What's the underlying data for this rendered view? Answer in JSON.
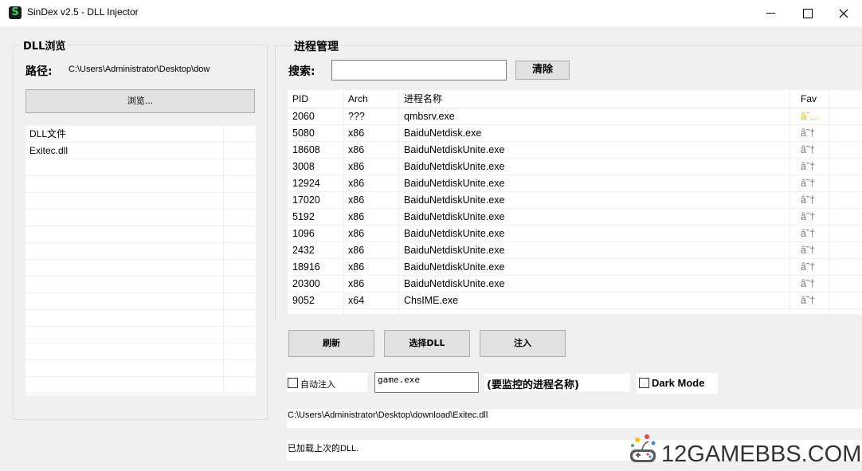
{
  "window": {
    "title": "SinDex v2.5 - DLL Injector",
    "icon_letter": "S"
  },
  "dll_panel": {
    "group_title": "DLL浏览",
    "path_label": "路径:",
    "path_value": "C:\\Users\\Administrator\\Desktop\\dow",
    "browse_button": "浏览...",
    "list_header": "DLL文件",
    "files": [
      "Exitec.dll"
    ]
  },
  "process_panel": {
    "group_title": "进程管理",
    "search_label": "搜索:",
    "search_value": "",
    "clear_button": "清除",
    "columns": {
      "pid": "PID",
      "arch": "Arch",
      "name": "进程名称",
      "fav": "Fav"
    },
    "rows": [
      {
        "pid": "2060",
        "arch": "???",
        "name": "qmbsrv.exe",
        "fav": "â˜…"
      },
      {
        "pid": "5080",
        "arch": "x86",
        "name": "BaiduNetdisk.exe",
        "fav": "â˜†"
      },
      {
        "pid": "18608",
        "arch": "x86",
        "name": "BaiduNetdiskUnite.exe",
        "fav": "â˜†"
      },
      {
        "pid": "3008",
        "arch": "x86",
        "name": "BaiduNetdiskUnite.exe",
        "fav": "â˜†"
      },
      {
        "pid": "12924",
        "arch": "x86",
        "name": "BaiduNetdiskUnite.exe",
        "fav": "â˜†"
      },
      {
        "pid": "17020",
        "arch": "x86",
        "name": "BaiduNetdiskUnite.exe",
        "fav": "â˜†"
      },
      {
        "pid": "5192",
        "arch": "x86",
        "name": "BaiduNetdiskUnite.exe",
        "fav": "â˜†"
      },
      {
        "pid": "1096",
        "arch": "x86",
        "name": "BaiduNetdiskUnite.exe",
        "fav": "â˜†"
      },
      {
        "pid": "2432",
        "arch": "x86",
        "name": "BaiduNetdiskUnite.exe",
        "fav": "â˜†"
      },
      {
        "pid": "18916",
        "arch": "x86",
        "name": "BaiduNetdiskUnite.exe",
        "fav": "â˜†"
      },
      {
        "pid": "20300",
        "arch": "x86",
        "name": "BaiduNetdiskUnite.exe",
        "fav": "â˜†"
      },
      {
        "pid": "9052",
        "arch": "x64",
        "name": "ChsIME.exe",
        "fav": "â˜†"
      }
    ],
    "fav_color": "#e8c200"
  },
  "actions": {
    "refresh": "刷新",
    "select_dll": "选择DLL",
    "inject": "注入"
  },
  "options": {
    "auto_inject_label": "自动注入",
    "monitor_value": "game.exe",
    "monitor_hint": "(要监控的进程名称)",
    "dark_mode_label": "Dark Mode"
  },
  "status": {
    "dll_path": "C:\\Users\\Administrator\\Desktop\\download\\Exitec.dll",
    "message": "已加载上次的DLL."
  },
  "watermark": {
    "text": "12GAMEBBS.COM"
  }
}
